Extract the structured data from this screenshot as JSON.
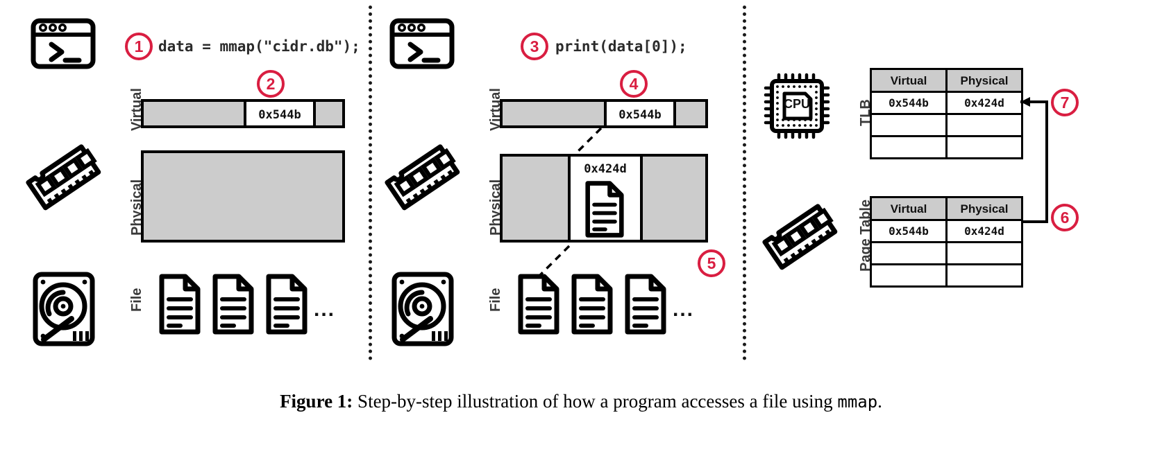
{
  "figure": {
    "caption_label": "Figure 1:",
    "caption_text": " Step-by-step illustration of how a program accesses a file using ",
    "caption_mono": "mmap",
    "caption_end": "."
  },
  "colors": {
    "accent": "#d91e41",
    "fill_gray": "#cccccc",
    "stroke": "#000000",
    "label_gray": "#3a3a3a"
  },
  "panels": [
    {
      "id": "panel-mmap-call",
      "terminal_icon": "terminal-icon",
      "ram_icon": "ram-stick-icon",
      "disk_icon": "hard-disk-icon",
      "steps": [
        {
          "number": "1",
          "caption": "data = mmap(\"cidr.db\");"
        },
        {
          "number": "2",
          "caption": ""
        }
      ],
      "code": "data = mmap(\"cidr.db\");",
      "rows": [
        {
          "label": "Virtual",
          "address": "0x544b",
          "populated": true
        },
        {
          "label": "Physical",
          "address": "",
          "populated": false
        },
        {
          "label": "File",
          "address": "",
          "populated": false
        }
      ],
      "file_pages": 3,
      "file_ellipsis": "..."
    },
    {
      "id": "panel-page-fault",
      "terminal_icon": "terminal-icon",
      "ram_icon": "ram-stick-icon",
      "disk_icon": "hard-disk-icon",
      "steps": [
        {
          "number": "3",
          "caption": "print(data[0]);"
        },
        {
          "number": "4",
          "caption": ""
        },
        {
          "number": "5",
          "caption": ""
        }
      ],
      "code": "print(data[0]);",
      "rows": [
        {
          "label": "Virtual",
          "address": "0x544b",
          "populated": true
        },
        {
          "label": "Physical",
          "address": "0x424d",
          "populated": true
        },
        {
          "label": "File",
          "address": "",
          "populated": false
        }
      ],
      "file_pages": 3,
      "file_ellipsis": "..."
    },
    {
      "id": "panel-address-translation",
      "cpu_icon": "cpu-chip-icon",
      "cpu_label": "CPU",
      "ram_icon": "ram-stick-icon",
      "steps": [
        {
          "number": "6",
          "caption": ""
        },
        {
          "number": "7",
          "caption": ""
        }
      ],
      "tables": [
        {
          "name": "TLB",
          "headers": [
            "Virtual",
            "Physical"
          ],
          "rows": [
            [
              "0x544b",
              "0x424d"
            ],
            [
              "",
              ""
            ],
            [
              "",
              ""
            ]
          ]
        },
        {
          "name": "Page Table",
          "headers": [
            "Virtual",
            "Physical"
          ],
          "rows": [
            [
              "0x544b",
              "0x424d"
            ],
            [
              "",
              ""
            ],
            [
              "",
              ""
            ]
          ]
        }
      ]
    }
  ]
}
